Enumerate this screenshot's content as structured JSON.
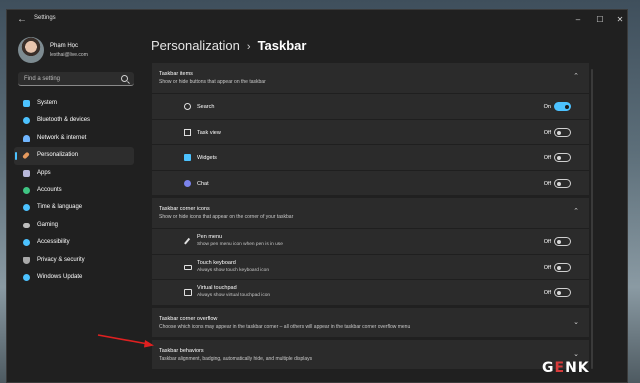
{
  "window": {
    "title": "Settings"
  },
  "profile": {
    "name": "Phạm Học",
    "email": "lexthai@live.com"
  },
  "search": {
    "placeholder": "Find a setting"
  },
  "sidebar": {
    "items": [
      {
        "label": "System",
        "icon": "monitor-icon",
        "color": "#4cc2ff"
      },
      {
        "label": "Bluetooth & devices",
        "icon": "bluetooth-icon",
        "color": "#4cc2ff"
      },
      {
        "label": "Network & internet",
        "icon": "wifi-icon",
        "color": "#70b6ff"
      },
      {
        "label": "Personalization",
        "icon": "brush-icon",
        "color": "#e59a5e",
        "selected": true
      },
      {
        "label": "Apps",
        "icon": "apps-icon",
        "color": "#b7b7d9"
      },
      {
        "label": "Accounts",
        "icon": "person-icon",
        "color": "#3fc583"
      },
      {
        "label": "Time & language",
        "icon": "globe-icon",
        "color": "#4cc2ff"
      },
      {
        "label": "Gaming",
        "icon": "gamepad-icon",
        "color": "#bdbdbd"
      },
      {
        "label": "Accessibility",
        "icon": "accessibility-icon",
        "color": "#4cc2ff"
      },
      {
        "label": "Privacy & security",
        "icon": "shield-icon",
        "color": "#a9a9a9"
      },
      {
        "label": "Windows Update",
        "icon": "update-icon",
        "color": "#4cc2ff"
      }
    ]
  },
  "breadcrumb": {
    "parent": "Personalization",
    "separator": "›",
    "current": "Taskbar"
  },
  "sections": {
    "items": {
      "title": "Taskbar items",
      "subtitle": "Show or hide buttons that appear on the taskbar",
      "rows": [
        {
          "label": "Search",
          "state": "On",
          "on": true,
          "icon": "search-icon"
        },
        {
          "label": "Task view",
          "state": "Off",
          "on": false,
          "icon": "task-view-icon"
        },
        {
          "label": "Widgets",
          "state": "Off",
          "on": false,
          "icon": "widgets-icon"
        },
        {
          "label": "Chat",
          "state": "Off",
          "on": false,
          "icon": "chat-icon"
        }
      ]
    },
    "corner_icons": {
      "title": "Taskbar corner icons",
      "subtitle": "Show or hide icons that appear on the corner of your taskbar",
      "rows": [
        {
          "label": "Pen menu",
          "sub": "Show pen menu icon when pen is in use",
          "state": "Off",
          "on": false,
          "icon": "pen-icon"
        },
        {
          "label": "Touch keyboard",
          "sub": "Always show touch keyboard icon",
          "state": "Off",
          "on": false,
          "icon": "keyboard-icon"
        },
        {
          "label": "Virtual touchpad",
          "sub": "Always show virtual touchpad icon",
          "state": "Off",
          "on": false,
          "icon": "touchpad-icon"
        }
      ]
    },
    "overflow": {
      "title": "Taskbar corner overflow",
      "subtitle": "Choose which icons may appear in the taskbar corner – all others will appear in the taskbar corner overflow menu"
    },
    "behaviors": {
      "title": "Taskbar behaviors",
      "subtitle": "Taskbar alignment, badging, automatically hide, and multiple displays"
    }
  },
  "watermark": {
    "brand_left": "G",
    "brand_e": "E",
    "brand_right": "NK"
  },
  "colors": {
    "accent": "#4cc2ff",
    "annotation_arrow": "#e02020"
  }
}
